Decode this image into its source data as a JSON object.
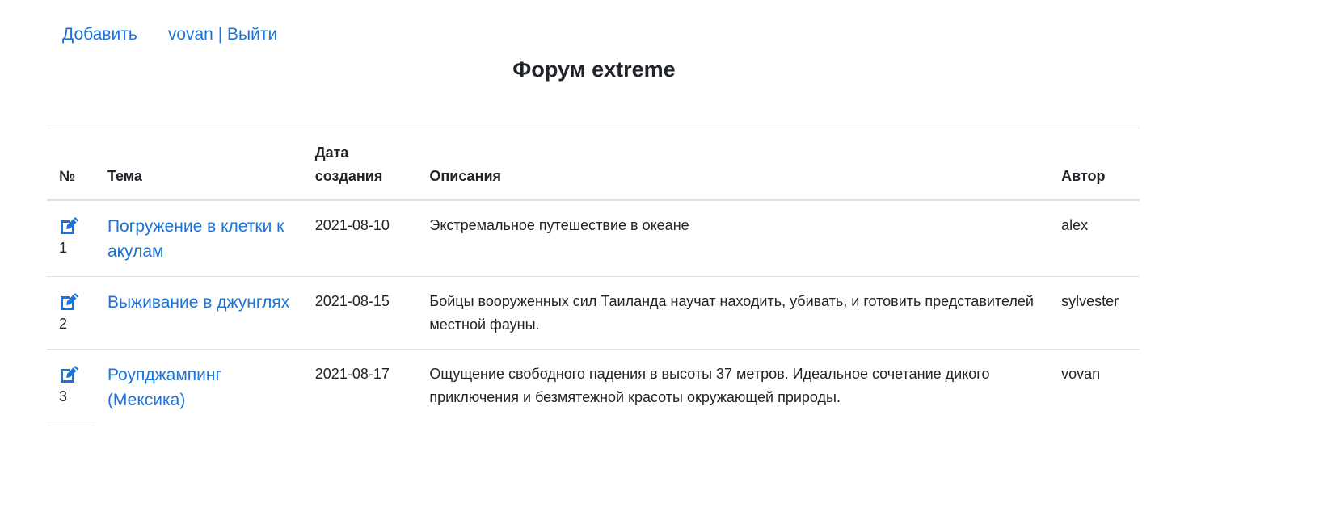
{
  "nav": {
    "add_label": "Добавить",
    "user_label": "vovan",
    "separator": "|",
    "logout_label": "Выйти"
  },
  "page": {
    "title": "Форум extreme"
  },
  "table": {
    "headers": {
      "num": "№",
      "topic": "Тема",
      "date": "Дата создания",
      "description": "Описания",
      "author": "Автор"
    },
    "rows": [
      {
        "num": "1",
        "topic": "Погружение в клетки к акулам",
        "date": "2021-08-10",
        "description": "Экстремальное путешествие в океане",
        "author": "alex"
      },
      {
        "num": "2",
        "topic": "Выживание в джунглях",
        "date": "2021-08-15",
        "description": "Бойцы вооруженных сил Таиланда научат находить, убивать, и готовить представителей местной фауны.",
        "author": "sylvester"
      },
      {
        "num": "3",
        "topic": "Роупджампинг (Мексика)",
        "date": "2021-08-17",
        "description": "Ощущение свободного падения в высоты 37 метров. Идеальное сочетание дикого приключения и безмятежной красоты окружающей природы.",
        "author": "vovan"
      }
    ]
  },
  "icons": {
    "edit": "edit-icon"
  },
  "colors": {
    "link": "#1a73d9",
    "text": "#212529",
    "border": "#dee2e6"
  }
}
